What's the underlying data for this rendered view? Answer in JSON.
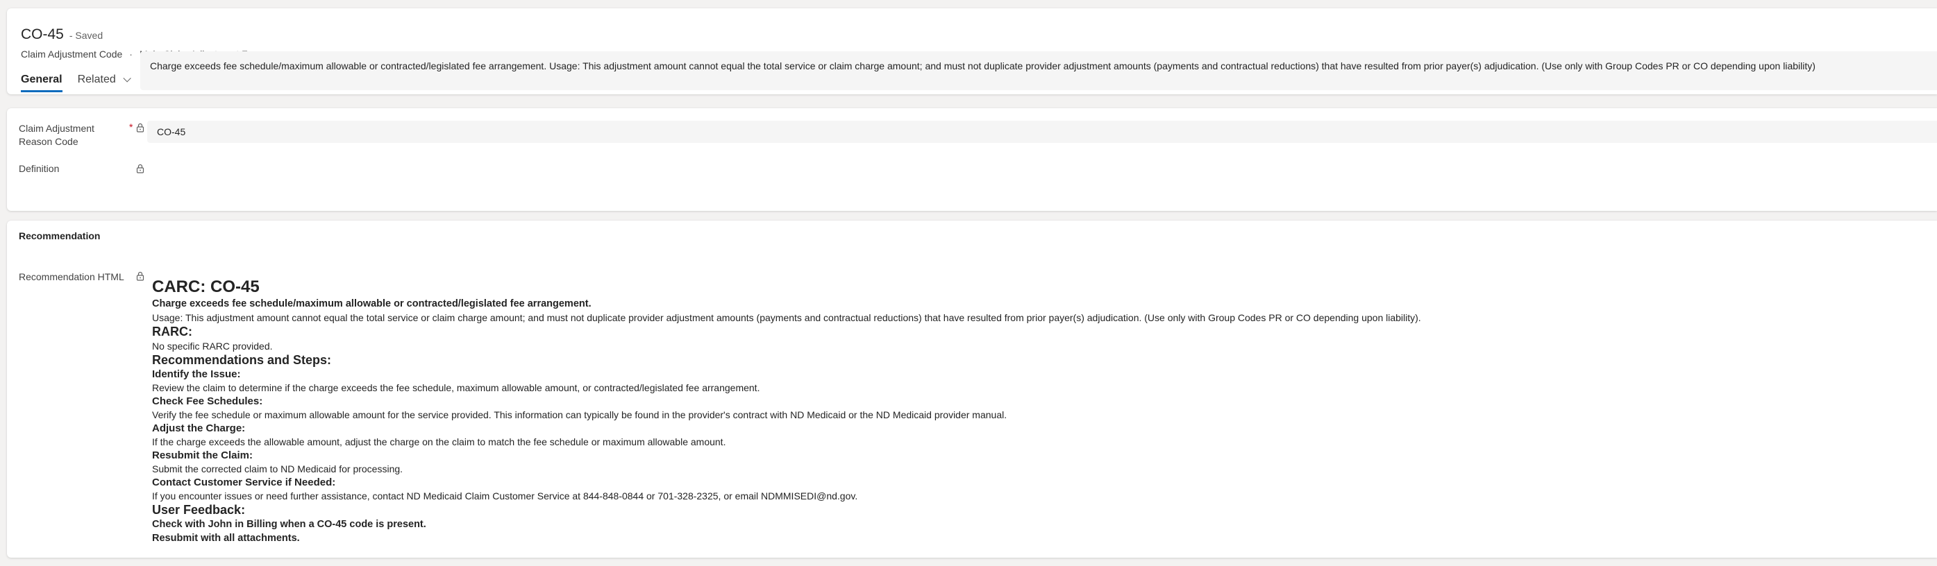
{
  "header": {
    "title": "CO-45",
    "status": "- Saved",
    "entity": "Claim Adjustment Code",
    "separator": "·",
    "form": "Main Claim Adjustment Form"
  },
  "tabs": [
    {
      "label": "General",
      "active": true
    },
    {
      "label": "Related",
      "active": false
    }
  ],
  "fields": {
    "reason_code": {
      "label_line1": "Claim Adjustment",
      "label_line2": "Reason Code",
      "required_mark": "*",
      "value": "CO-45"
    },
    "definition": {
      "label": "Definition",
      "value": "Charge exceeds fee schedule/maximum allowable or contracted/legislated fee arrangement. Usage: This adjustment amount cannot equal the total service or claim charge amount; and must not duplicate provider adjustment amounts (payments and contractual reductions) that have resulted from prior payer(s) adjudication. (Use only with Group Codes PR or CO depending upon liability)"
    }
  },
  "recommendation": {
    "section_title": "Recommendation",
    "field_label": "Recommendation HTML",
    "carc_heading": "CARC: CO-45",
    "carc_summary": "Charge exceeds fee schedule/maximum allowable or contracted/legislated fee arrangement.",
    "carc_usage": "Usage: This adjustment amount cannot equal the total service or claim charge amount; and must not duplicate provider adjustment amounts (payments and contractual reductions) that have resulted from prior payer(s) adjudication. (Use only with Group Codes PR or CO depending upon liability).",
    "rarc_heading": "RARC:",
    "rarc_text": "No specific RARC provided.",
    "steps_heading": "Recommendations and Steps:",
    "steps": [
      {
        "title": "Identify the Issue:",
        "text": "Review the claim to determine if the charge exceeds the fee schedule, maximum allowable amount, or contracted/legislated fee arrangement."
      },
      {
        "title": "Check Fee Schedules:",
        "text": "Verify the fee schedule or maximum allowable amount for the service provided. This information can typically be found in the provider's contract with ND Medicaid or the ND Medicaid provider manual."
      },
      {
        "title": "Adjust the Charge:",
        "text": "If the charge exceeds the allowable amount, adjust the charge on the claim to match the fee schedule or maximum allowable amount."
      },
      {
        "title": "Resubmit the Claim:",
        "text": "Submit the corrected claim to ND Medicaid for processing."
      },
      {
        "title": "Contact Customer Service if Needed:",
        "text": "If you encounter issues or need further assistance, contact ND Medicaid Claim Customer Service at 844-848-0844 or 701-328-2325, or email NDMMISEDI@nd.gov."
      }
    ],
    "feedback_heading": "User Feedback:",
    "feedback_lines": [
      "Check with John in Billing when a CO-45 code is present.",
      "Resubmit with all attachments."
    ]
  },
  "colors": {
    "accent": "#0f6cbd",
    "required": "#c50f1f",
    "background": "#f3f2f1",
    "field_bg": "#f5f5f5"
  },
  "icons": {
    "lock": "lock-icon",
    "chevron": "chevron-down-icon"
  }
}
